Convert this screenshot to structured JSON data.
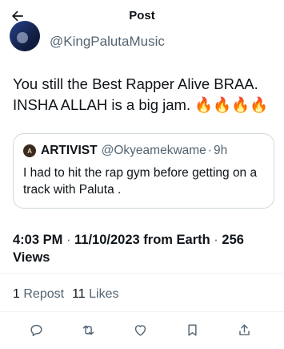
{
  "header": {
    "title": "Post"
  },
  "author": {
    "handle": "@KingPalutaMusic"
  },
  "tweet": {
    "line1": "You still the Best Rapper Alive BRAA.",
    "line2": "INSHA ALLAH is a big jam. 🔥🔥🔥🔥"
  },
  "quote": {
    "name": "ARTIVIST",
    "handle": "@Okyeamekwame",
    "separator": "·",
    "time": "9h",
    "text": "I had to hit the rap gym before getting on a track with Paluta ."
  },
  "meta": {
    "time": "4:03 PM",
    "sep1": " · ",
    "date": "11/10/2023",
    "location": " from Earth",
    "sep2": " · ",
    "views_count": "256",
    "views_label": "Views"
  },
  "stats": {
    "reposts_count": "1",
    "reposts_label": "Repost",
    "likes_count": "11",
    "likes_label": "Likes"
  },
  "icons": {
    "back": "arrow-left-icon",
    "reply": "reply-icon",
    "repost": "repost-icon",
    "like": "heart-icon",
    "bookmark": "bookmark-icon",
    "share": "share-icon"
  }
}
